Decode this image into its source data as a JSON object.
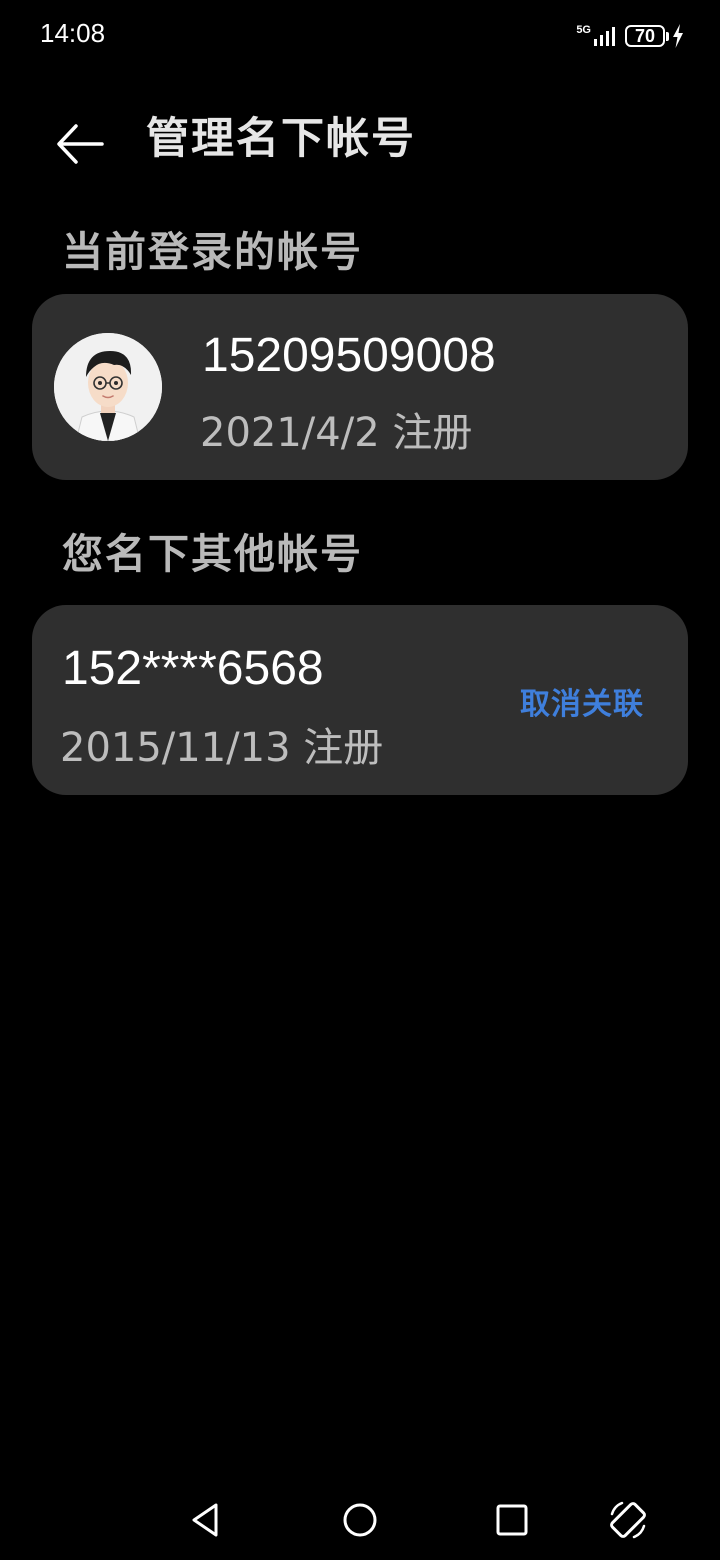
{
  "status_bar": {
    "time": "14:08",
    "network_type": "5G",
    "battery_level": "70",
    "charging": true
  },
  "header": {
    "back_icon": "arrow-left-icon",
    "title": "管理名下帐号"
  },
  "current_account": {
    "section_title": "当前登录的帐号",
    "avatar_icon": "avatar-cartoon-man",
    "number": "15209509008",
    "registered": "2021/4/2 注册"
  },
  "other_accounts": {
    "section_title": "您名下其他帐号",
    "items": [
      {
        "number": "152****6568",
        "registered": "2015/11/13 注册",
        "action_label": "取消关联",
        "action_color": "#3f7fdc"
      }
    ]
  },
  "nav_bar": {
    "back_icon": "triangle-back-icon",
    "home_icon": "circle-home-icon",
    "recent_icon": "square-recents-icon",
    "rotate_icon": "screen-rotate-icon"
  },
  "colors": {
    "background": "#000000",
    "card": "#2f2f2f",
    "accent": "#3f7fdc"
  }
}
